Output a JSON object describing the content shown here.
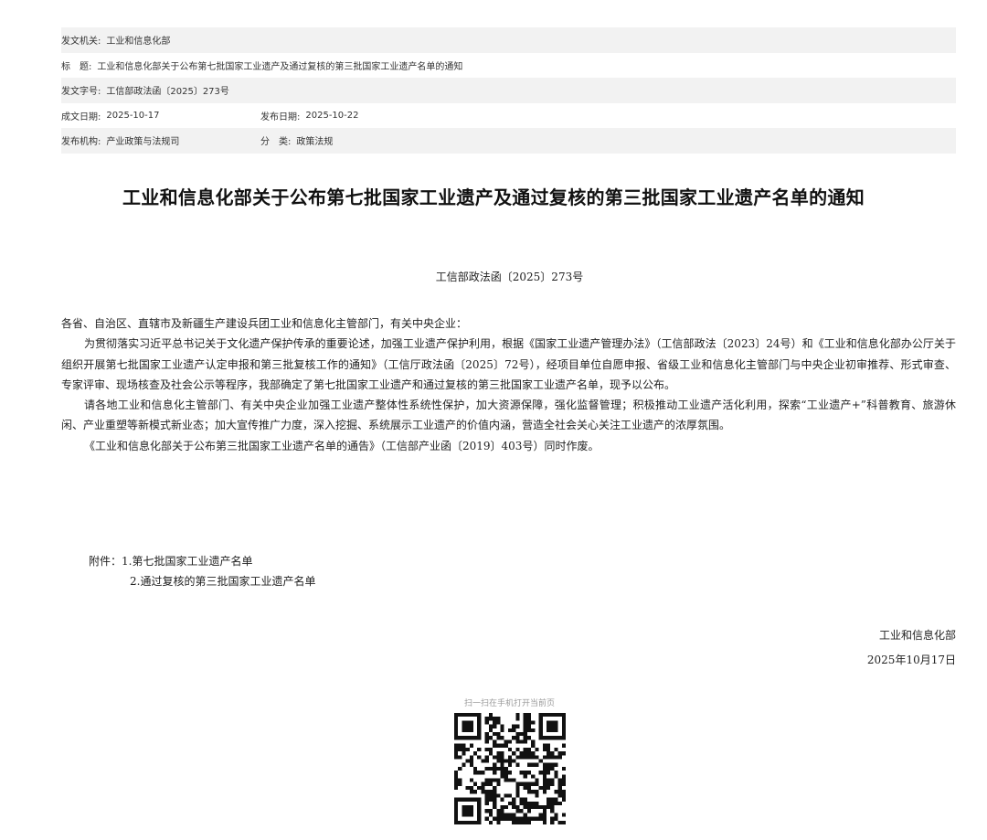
{
  "meta": {
    "issuer_label": "发文机关:",
    "issuer": "工业和信息化部",
    "title_label": "标　题:",
    "title": "工业和信息化部关于公布第七批国家工业遗产及通过复核的第三批国家工业遗产名单的通知",
    "docno_label": "发文字号:",
    "docno": "工信部政法函〔2025〕273号",
    "created_label": "成文日期:",
    "created": "2025-10-17",
    "published_label": "发布日期:",
    "published": "2025-10-22",
    "org_label": "发布机构:",
    "org": "产业政策与法规司",
    "category_label": "分　类:",
    "category": "政策法规"
  },
  "document": {
    "title": "工业和信息化部关于公布第七批国家工业遗产及通过复核的第三批国家工业遗产名单的通知",
    "number": "工信部政法函〔2025〕273号",
    "salutation": "各省、自治区、直辖市及新疆生产建设兵团工业和信息化主管部门，有关中央企业：",
    "paragraphs": [
      "为贯彻落实习近平总书记关于文化遗产保护传承的重要论述，加强工业遗产保护利用，根据《国家工业遗产管理办法》（工信部政法〔2023〕24号）和《工业和信息化部办公厅关于组织开展第七批国家工业遗产认定申报和第三批复核工作的通知》（工信厅政法函〔2025〕72号），经项目单位自愿申报、省级工业和信息化主管部门与中央企业初审推荐、形式审查、专家评审、现场核查及社会公示等程序，我部确定了第七批国家工业遗产和通过复核的第三批国家工业遗产名单，现予以公布。",
      "请各地工业和信息化主管部门、有关中央企业加强工业遗产整体性系统性保护，加大资源保障，强化监督管理；积极推动工业遗产活化利用，探索“工业遗产+”科普教育、旅游休闲、产业重塑等新模式新业态；加大宣传推广力度，深入挖掘、系统展示工业遗产的价值内涵，营造全社会关心关注工业遗产的浓厚氛围。",
      "《工业和信息化部关于公布第三批国家工业遗产名单的通告》（工信部产业函〔2019〕403号）同时作废。"
    ],
    "attachments_label": "附件：",
    "attachments": [
      "1.第七批国家工业遗产名单",
      "2.通过复核的第三批国家工业遗产名单"
    ],
    "signer": "工业和信息化部",
    "date": "2025年10月17日"
  },
  "qr": {
    "caption": "扫一扫在手机打开当前页",
    "icon": "qr-code-icon"
  }
}
